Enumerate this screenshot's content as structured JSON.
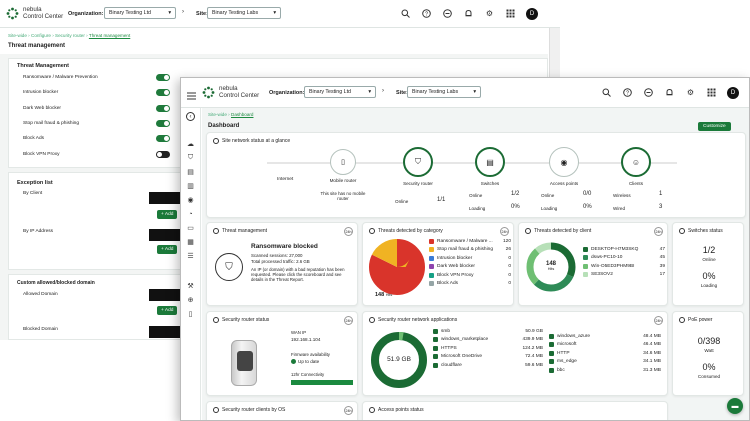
{
  "back": {
    "org_label": "Organization:",
    "org_value": "Binary Testing Ltd",
    "site_label": "Site:",
    "site_value": "Binary Testing Labs",
    "breadcrumb": [
      "Site-wide",
      "Configure",
      "Security router",
      "Threat management"
    ],
    "page_title": "Threat management",
    "section_title": "Threat Management",
    "toggles": [
      {
        "label": "Ransomware / Malware Prevention",
        "on": true
      },
      {
        "label": "Intrusion blocker",
        "on": true
      },
      {
        "label": "Dark Web blocker",
        "on": true
      },
      {
        "label": "Stop mail fraud & phishing",
        "on": true
      },
      {
        "label": "Block Ads",
        "on": true
      },
      {
        "label": "Block VPN Proxy",
        "on": false
      }
    ],
    "exception_title": "Exception list",
    "by_client": "By Client",
    "by_ip": "By IP Address",
    "add": "+ Add",
    "custom_title": "Custom allowed/blocked domain",
    "allowed": "Allowed Domain",
    "blocked": "Blocked Domain"
  },
  "front": {
    "brand_top": "nebula",
    "brand_bottom": "Control Center",
    "org_label": "Organization:",
    "org_value": "Binary Testing Ltd",
    "site_label": "Site:",
    "site_value": "Binary Testing Labs",
    "breadcrumb_a": "Site-wide",
    "breadcrumb_b": "Dashboard",
    "page_title": "Dashboard",
    "customize": "Customize",
    "glance_title": "Site network status at a glance",
    "internet": "Internet",
    "nodes": [
      {
        "label": "Mobile router",
        "sub": "This site has no mobile router"
      },
      {
        "label": "Security router",
        "stat1_label": "Online",
        "stat1_value": "1/1"
      },
      {
        "label": "Switches",
        "stat1_label": "Online",
        "stat1_value": "1/2",
        "stat2_label": "Loading",
        "stat2_value": "0%"
      },
      {
        "label": "Access points",
        "stat1_label": "Online",
        "stat1_value": "0/0",
        "stat2_label": "Loading",
        "stat2_value": "0%"
      },
      {
        "label": "Clients",
        "stat1_label": "Wireless",
        "stat1_value": "1",
        "stat2_label": "Wired",
        "stat2_value": "3"
      }
    ],
    "threat_mgmt": {
      "title": "Threat management",
      "badge": "24h",
      "headline": "Ransomware blocked",
      "line1": "Scanned sessions: 27,000",
      "line2": "Total processed traffic: 2.6 GB",
      "line3": "An IP (or domain) with a bad reputation has been requested. Please click the scoreboard and see details in the Threat Report."
    },
    "threats_category": {
      "title": "Threats detected by category",
      "badge": "24h",
      "center": "148",
      "center_unit": "Hits",
      "items": [
        {
          "label": "Ransomware / Malware ...",
          "value": "120",
          "color": "#d9342b"
        },
        {
          "label": "Stop mail fraud & phishing",
          "value": "26",
          "color": "#f0b323"
        },
        {
          "label": "Intrusion blocker",
          "value": "0",
          "color": "#3a7bd5"
        },
        {
          "label": "Dark Web blocker",
          "value": "0",
          "color": "#8e44ad"
        },
        {
          "label": "Block VPN Proxy",
          "value": "0",
          "color": "#16a085"
        },
        {
          "label": "Block Ads",
          "value": "0",
          "color": "#95a5a6"
        }
      ]
    },
    "threats_client": {
      "title": "Threats detected by client",
      "badge": "24h",
      "center": "148",
      "center_unit": "Hits",
      "items": [
        {
          "label": "DESKTOP-H7M3SKQ",
          "value": "47",
          "color": "#1b6b34"
        },
        {
          "label": "dsws-PC10-10",
          "value": "45",
          "color": "#2e8b57"
        },
        {
          "label": "Win-O5ED3PHM9BI",
          "value": "39",
          "color": "#6fbf73"
        },
        {
          "label": "SE3SOV2",
          "value": "17",
          "color": "#b7e0b8"
        }
      ]
    },
    "switches_status": {
      "title": "Switches status",
      "badge": "24h",
      "online_value": "1/2",
      "online_label": "Online",
      "loading_value": "0%",
      "loading_label": "Loading"
    },
    "router_status": {
      "title": "Security router status",
      "badge": "24h",
      "wan_label": "WAN IP",
      "wan_value": "192.168.1.104",
      "fw_label": "Firmware availability",
      "fw_value": "Up to date",
      "conn_label": "12hr Connectivity"
    },
    "net_apps": {
      "title": "Security router network applications",
      "badge": "24h",
      "center": "51.9 GB",
      "left": [
        {
          "label": "smb",
          "value": "50.9 GB"
        },
        {
          "label": "windows_marketplace",
          "value": "439.9 MB"
        },
        {
          "label": "HTTPS",
          "value": "124.2 MB"
        },
        {
          "label": "Microsoft OneDrive",
          "value": "72.4 MB"
        },
        {
          "label": "cloudflare",
          "value": "59.6 MB"
        }
      ],
      "right": [
        {
          "label": "windows_azure",
          "value": "48.4 MB"
        },
        {
          "label": "microsoft",
          "value": "46.4 MB"
        },
        {
          "label": "HTTP",
          "value": "34.6 MB"
        },
        {
          "label": "ms_edge",
          "value": "34.1 MB"
        },
        {
          "label": "bbc",
          "value": "31.3 MB"
        }
      ]
    },
    "poe": {
      "title": "PoE power",
      "badge": "24h",
      "val1": "0/398",
      "lbl1": "Watt",
      "val2": "0%",
      "lbl2": "Consumed"
    },
    "clients_os": {
      "title": "Security router clients by OS",
      "badge": "24h"
    },
    "ap_status": {
      "title": "Access points status"
    }
  }
}
